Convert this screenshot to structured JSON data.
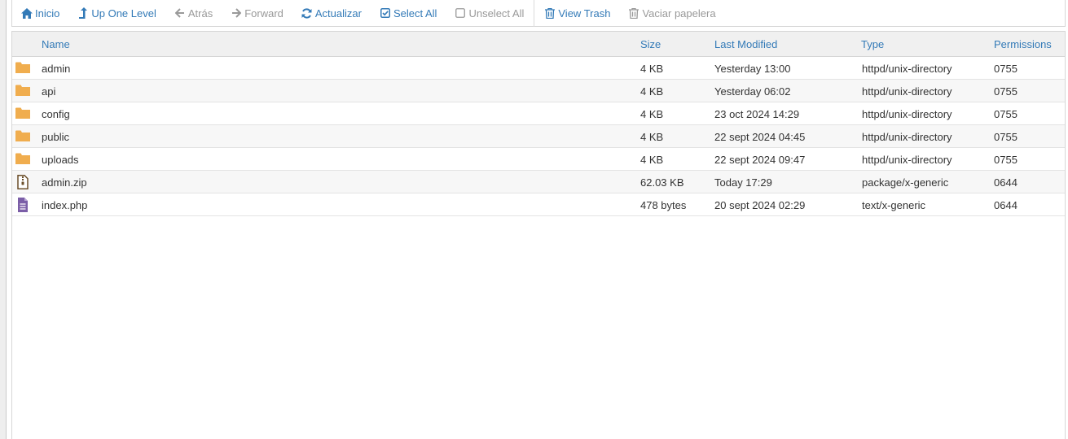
{
  "toolbar": {
    "home": "Inicio",
    "up": "Up One Level",
    "back": "Atrás",
    "forward": "Forward",
    "reload": "Actualizar",
    "select_all": "Select All",
    "unselect_all": "Unselect All",
    "view_trash": "View Trash",
    "empty_trash": "Vaciar papelera"
  },
  "columns": {
    "name": "Name",
    "size": "Size",
    "modified": "Last Modified",
    "type": "Type",
    "permissions": "Permissions"
  },
  "files": [
    {
      "name": "admin",
      "size": "4 KB",
      "modified": "Yesterday 13:00",
      "type": "httpd/unix-directory",
      "perm": "0755",
      "icon": "folder-icon"
    },
    {
      "name": "api",
      "size": "4 KB",
      "modified": "Yesterday 06:02",
      "type": "httpd/unix-directory",
      "perm": "0755",
      "icon": "folder-icon"
    },
    {
      "name": "config",
      "size": "4 KB",
      "modified": "23 oct 2024 14:29",
      "type": "httpd/unix-directory",
      "perm": "0755",
      "icon": "folder-icon"
    },
    {
      "name": "public",
      "size": "4 KB",
      "modified": "22 sept 2024 04:45",
      "type": "httpd/unix-directory",
      "perm": "0755",
      "icon": "folder-icon"
    },
    {
      "name": "uploads",
      "size": "4 KB",
      "modified": "22 sept 2024 09:47",
      "type": "httpd/unix-directory",
      "perm": "0755",
      "icon": "folder-icon"
    },
    {
      "name": "admin.zip",
      "size": "62.03 KB",
      "modified": "Today 17:29",
      "type": "package/x-generic",
      "perm": "0644",
      "icon": "zip-file-icon"
    },
    {
      "name": "index.php",
      "size": "478 bytes",
      "modified": "20 sept 2024 02:29",
      "type": "text/x-generic",
      "perm": "0644",
      "icon": "text-file-icon"
    }
  ],
  "colors": {
    "link": "#337ab7",
    "disabled": "#999999",
    "folder": "#f0ad4e",
    "zip": "#8a6d3b",
    "text_file": "#7b5ea7"
  }
}
